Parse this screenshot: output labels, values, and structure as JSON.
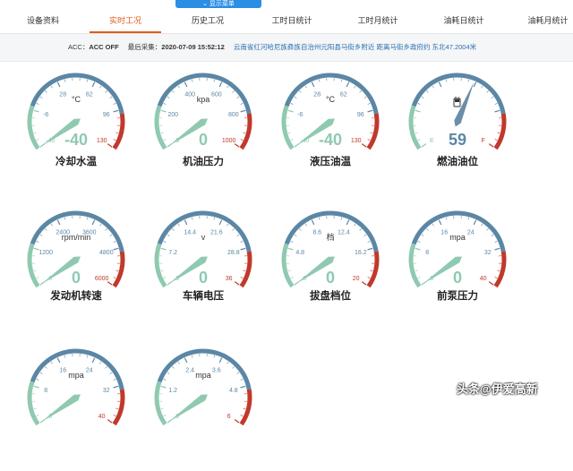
{
  "dropdown_label": "显示菜单",
  "tabs": [
    {
      "label": "设备资料",
      "active": false
    },
    {
      "label": "实时工况",
      "active": true
    },
    {
      "label": "历史工况",
      "active": false
    },
    {
      "label": "工时日统计",
      "active": false
    },
    {
      "label": "工时月统计",
      "active": false
    },
    {
      "label": "油耗日统计",
      "active": false
    },
    {
      "label": "油耗月统计",
      "active": false
    }
  ],
  "info": {
    "acc_label": "ACC：",
    "acc_value": "ACC OFF",
    "last_label": "最后采集：",
    "last_value": "2020-07-09 15:52:12",
    "location": "云南省红河哈尼族彝族自治州元阳县马街乡附近 距离马街乡政府约 东北47.2004米"
  },
  "colors": {
    "accent": "#e25a1c",
    "arc_blue": "#5b87a5",
    "arc_green": "#8fc9b0",
    "arc_red": "#c0392b",
    "needle_green": "#8fc9b0",
    "needle_blue": "#6c8ea8",
    "value_blue": "#5b87a5"
  },
  "gauges": [
    {
      "name": "冷却水温",
      "unit": "°C",
      "ticks": [
        "-40",
        "-6",
        "28",
        "62",
        "96",
        "130"
      ],
      "value": "-40",
      "reading": -40
    },
    {
      "name": "机油压力",
      "unit": "kpa",
      "ticks": [
        "0",
        "200",
        "400",
        "600",
        "800",
        "1000"
      ],
      "value": "0",
      "reading": 0
    },
    {
      "name": "液压油温",
      "unit": "°C",
      "ticks": [
        "-40",
        "-6",
        "28",
        "62",
        "96",
        "130"
      ],
      "value": "-40",
      "reading": -40
    },
    {
      "name": "燃油油位",
      "unit": "%",
      "ticks": [
        "E",
        "",
        "",
        "",
        "",
        "F"
      ],
      "value": "59",
      "reading": 59,
      "fuel": true
    },
    {
      "name": "发动机转速",
      "unit": "rpm/min",
      "ticks": [
        "0",
        "1200",
        "2400",
        "3600",
        "4800",
        "6000"
      ],
      "value": "0",
      "reading": 0
    },
    {
      "name": "车辆电压",
      "unit": "v",
      "ticks": [
        "0",
        "7.2",
        "14.4",
        "21.6",
        "28.8",
        "36"
      ],
      "value": "0",
      "reading": 0
    },
    {
      "name": "拔盘档位",
      "unit": "档",
      "ticks": [
        "0",
        "4.8",
        "8.6",
        "12.4",
        "16.2",
        "20"
      ],
      "value": "0",
      "reading": 0
    },
    {
      "name": "前泵压力",
      "unit": "mpa",
      "ticks": [
        "0",
        "8",
        "16",
        "24",
        "32",
        "40"
      ],
      "value": "0",
      "reading": 0
    },
    {
      "name": "",
      "unit": "mpa",
      "ticks": [
        "0",
        "8",
        "16",
        "24",
        "32",
        "40"
      ],
      "value": "",
      "reading": 0
    },
    {
      "name": "",
      "unit": "mpa",
      "ticks": [
        "0",
        "1.2",
        "2.4",
        "3.6",
        "4.8",
        "6"
      ],
      "value": "",
      "reading": 0
    }
  ],
  "watermark": "头条@伊爱高新"
}
